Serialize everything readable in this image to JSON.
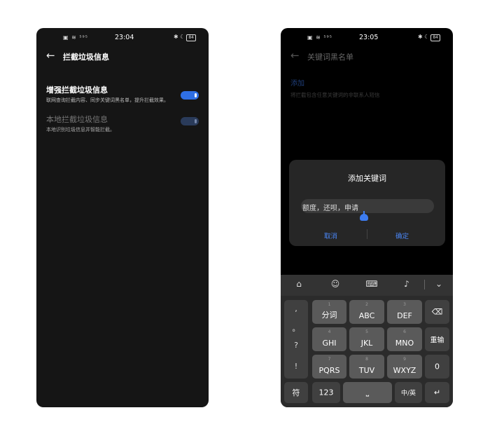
{
  "left_screen": {
    "status": {
      "left": "▣ ≋ ⁵⁹⁵",
      "time": "23:04",
      "right": "✱ ☾",
      "battery": "84"
    },
    "title": "拦截垃圾信息",
    "settings": [
      {
        "title": "增强拦截垃圾信息",
        "desc": "联网查询拦截内容、同步关键词黑名单，提升拦截效果。",
        "enabled": true
      },
      {
        "title": "本地拦截垃圾信息",
        "desc": "本地识别垃圾信息并智能拦截。",
        "enabled": true
      }
    ]
  },
  "right_screen": {
    "status": {
      "left": "▣ ≋ ⁵⁹⁵",
      "time": "23:05",
      "right": "✱ ☾",
      "battery": "84"
    },
    "title": "关键词黑名单",
    "add_label": "添加",
    "hint": "将拦截包含任意关键词的非联系人短信",
    "dialog": {
      "title": "添加关键词",
      "input_value": "额度，还呗，申请",
      "cancel": "取消",
      "confirm": "确定"
    },
    "keyboard": {
      "symbols": [
        ",",
        "。",
        "?",
        "!"
      ],
      "rows": [
        [
          {
            "num": "1",
            "label": "分词"
          },
          {
            "num": "2",
            "label": "ABC"
          },
          {
            "num": "3",
            "label": "DEF"
          }
        ],
        [
          {
            "num": "4",
            "label": "GHI"
          },
          {
            "num": "5",
            "label": "JKL"
          },
          {
            "num": "6",
            "label": "MNO"
          }
        ],
        [
          {
            "num": "7",
            "label": "PQRS"
          },
          {
            "num": "8",
            "label": "TUV"
          },
          {
            "num": "9",
            "label": "WXYZ"
          }
        ]
      ],
      "right_keys": [
        "⌫",
        "重输",
        "0"
      ],
      "bottom": {
        "symbol": "符",
        "numbers": "123",
        "space_mic": "⎵",
        "lang": "中/英",
        "enter": "↵"
      }
    }
  },
  "colors": {
    "accent": "#2f6fe4",
    "background": "#151515"
  }
}
